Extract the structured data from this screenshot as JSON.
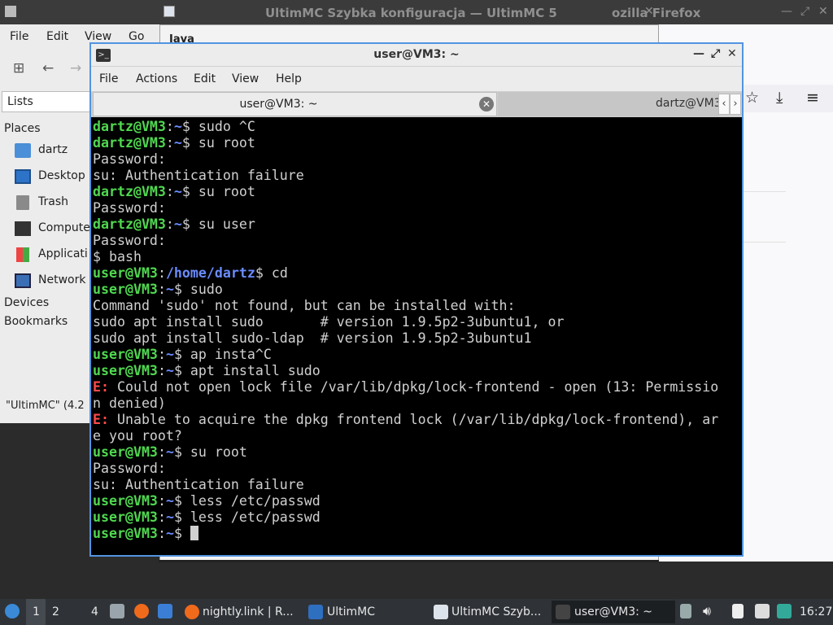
{
  "bg_window": {
    "title": "UltimMC Szybka konfiguracja — UltimMC 5",
    "right_title": "ozilla Firefox"
  },
  "file_manager": {
    "menu": [
      "File",
      "Edit",
      "View",
      "Go"
    ],
    "lists_label": "Lists",
    "places_header": "Places",
    "places": [
      "dartz",
      "Desktop",
      "Trash",
      "Compute",
      "Applicati",
      "Network"
    ],
    "devices_header": "Devices",
    "bookmarks_header": "Bookmarks",
    "status": "\"UltimMC\" (4.2"
  },
  "ultimmc": {
    "java_label": "Java"
  },
  "terminal": {
    "title": "user@VM3: ~",
    "menu": [
      "File",
      "Actions",
      "Edit",
      "View",
      "Help"
    ],
    "tab_active": "user@VM3: ~",
    "tab_inactive": "dartz@VM3",
    "lines": [
      [
        {
          "c": "pg",
          "t": "dartz@VM3"
        },
        {
          "c": "",
          "t": ":"
        },
        {
          "c": "pb",
          "t": "~"
        },
        {
          "c": "",
          "t": "$ sudo ^C"
        }
      ],
      [
        {
          "c": "pg",
          "t": "dartz@VM3"
        },
        {
          "c": "",
          "t": ":"
        },
        {
          "c": "pb",
          "t": "~"
        },
        {
          "c": "",
          "t": "$ su root"
        }
      ],
      [
        {
          "c": "",
          "t": "Password:"
        }
      ],
      [
        {
          "c": "",
          "t": "su: Authentication failure"
        }
      ],
      [
        {
          "c": "pg",
          "t": "dartz@VM3"
        },
        {
          "c": "",
          "t": ":"
        },
        {
          "c": "pb",
          "t": "~"
        },
        {
          "c": "",
          "t": "$ su root"
        }
      ],
      [
        {
          "c": "",
          "t": "Password:"
        }
      ],
      [
        {
          "c": "pg",
          "t": "dartz@VM3"
        },
        {
          "c": "",
          "t": ":"
        },
        {
          "c": "pb",
          "t": "~"
        },
        {
          "c": "",
          "t": "$ su user"
        }
      ],
      [
        {
          "c": "",
          "t": "Password:"
        }
      ],
      [
        {
          "c": "",
          "t": "$ bash"
        }
      ],
      [
        {
          "c": "pg",
          "t": "user@VM3"
        },
        {
          "c": "",
          "t": ":"
        },
        {
          "c": "pb",
          "t": "/home/dartz"
        },
        {
          "c": "",
          "t": "$ cd"
        }
      ],
      [
        {
          "c": "pg",
          "t": "user@VM3"
        },
        {
          "c": "",
          "t": ":"
        },
        {
          "c": "pb",
          "t": "~"
        },
        {
          "c": "",
          "t": "$ sudo"
        }
      ],
      [
        {
          "c": "",
          "t": "Command 'sudo' not found, but can be installed with:"
        }
      ],
      [
        {
          "c": "",
          "t": "sudo apt install sudo       # version 1.9.5p2-3ubuntu1, or"
        }
      ],
      [
        {
          "c": "",
          "t": "sudo apt install sudo-ldap  # version 1.9.5p2-3ubuntu1"
        }
      ],
      [
        {
          "c": "pg",
          "t": "user@VM3"
        },
        {
          "c": "",
          "t": ":"
        },
        {
          "c": "pb",
          "t": "~"
        },
        {
          "c": "",
          "t": "$ ap insta^C"
        }
      ],
      [
        {
          "c": "pg",
          "t": "user@VM3"
        },
        {
          "c": "",
          "t": ":"
        },
        {
          "c": "pb",
          "t": "~"
        },
        {
          "c": "",
          "t": "$ apt install sudo"
        }
      ],
      [
        {
          "c": "er",
          "t": "E:"
        },
        {
          "c": "",
          "t": " Could not open lock file /var/lib/dpkg/lock-frontend - open (13: Permissio"
        }
      ],
      [
        {
          "c": "",
          "t": "n denied)"
        }
      ],
      [
        {
          "c": "er",
          "t": "E:"
        },
        {
          "c": "",
          "t": " Unable to acquire the dpkg frontend lock (/var/lib/dpkg/lock-frontend), ar"
        }
      ],
      [
        {
          "c": "",
          "t": "e you root?"
        }
      ],
      [
        {
          "c": "pg",
          "t": "user@VM3"
        },
        {
          "c": "",
          "t": ":"
        },
        {
          "c": "pb",
          "t": "~"
        },
        {
          "c": "",
          "t": "$ su root"
        }
      ],
      [
        {
          "c": "",
          "t": "Password:"
        }
      ],
      [
        {
          "c": "",
          "t": "su: Authentication failure"
        }
      ],
      [
        {
          "c": "pg",
          "t": "user@VM3"
        },
        {
          "c": "",
          "t": ":"
        },
        {
          "c": "pb",
          "t": "~"
        },
        {
          "c": "",
          "t": "$ less /etc/passwd"
        }
      ],
      [
        {
          "c": "pg",
          "t": "user@VM3"
        },
        {
          "c": "",
          "t": ":"
        },
        {
          "c": "pb",
          "t": "~"
        },
        {
          "c": "",
          "t": "$ less /etc/passwd"
        }
      ],
      [
        {
          "c": "pg",
          "t": "user@VM3"
        },
        {
          "c": "",
          "t": ":"
        },
        {
          "c": "pb",
          "t": "~"
        },
        {
          "c": "",
          "t": "$ "
        }
      ]
    ]
  },
  "taskbar": {
    "workspaces": [
      "1",
      "2",
      "4"
    ],
    "tasks": [
      "nightly.link | R...",
      "UltimMC",
      "UltimMC Szyb...",
      "user@VM3: ~"
    ],
    "clock": "16:27"
  }
}
